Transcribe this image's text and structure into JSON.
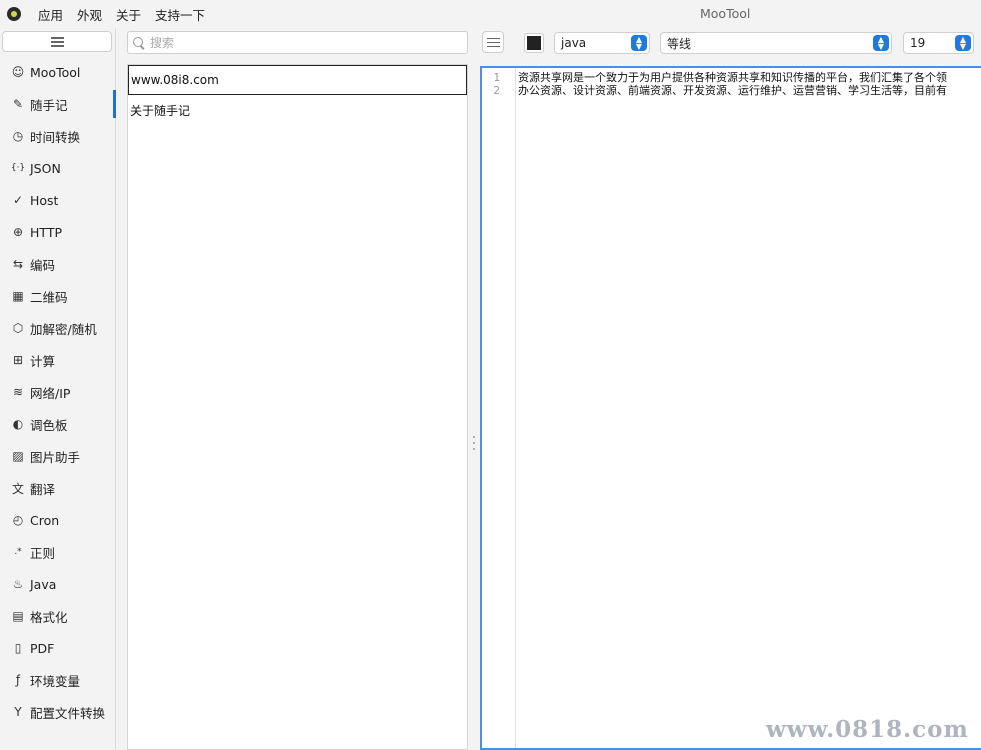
{
  "menu": [
    "应用",
    "外观",
    "关于",
    "支持一下"
  ],
  "window_title": "MooTool",
  "sidebar": {
    "items": [
      {
        "label": "MooTool",
        "icon": "smiley-icon"
      },
      {
        "label": "随手记",
        "icon": "pencil-icon",
        "active": true
      },
      {
        "label": "时间转换",
        "icon": "clock-icon"
      },
      {
        "label": "JSON",
        "icon": "braces-icon"
      },
      {
        "label": "Host",
        "icon": "checkmark-icon"
      },
      {
        "label": "HTTP",
        "icon": "globe-icon"
      },
      {
        "label": "编码",
        "icon": "swap-arrows-icon"
      },
      {
        "label": "二维码",
        "icon": "qrcode-icon"
      },
      {
        "label": "加解密/随机",
        "icon": "cube-icon"
      },
      {
        "label": "计算",
        "icon": "calculator-icon"
      },
      {
        "label": "网络/IP",
        "icon": "wifi-icon"
      },
      {
        "label": "调色板",
        "icon": "palette-icon"
      },
      {
        "label": "图片助手",
        "icon": "image-icon"
      },
      {
        "label": "翻译",
        "icon": "translate-icon"
      },
      {
        "label": "Cron",
        "icon": "cron-icon"
      },
      {
        "label": "正则",
        "icon": "regex-icon"
      },
      {
        "label": "Java",
        "icon": "java-icon"
      },
      {
        "label": "格式化",
        "icon": "paint-roller-icon"
      },
      {
        "label": "PDF",
        "icon": "pdf-icon"
      },
      {
        "label": "环境变量",
        "icon": "function-icon"
      },
      {
        "label": "配置文件转换",
        "icon": "yml-icon"
      }
    ]
  },
  "search": {
    "placeholder": "搜索",
    "value": ""
  },
  "notes": [
    {
      "title": "www.08i8.com",
      "selected": true
    },
    {
      "title": "关于随手记",
      "selected": false
    }
  ],
  "toolbar": {
    "color": "#222222",
    "language": "java",
    "font": "等线",
    "font_size": "19"
  },
  "editor": {
    "lines": [
      "资源共享网是一个致力于为用户提供各种资源共享和知识传播的平台，我们汇集了各个领",
      "办公资源、设计资源、前端资源、开发资源、运行维护、运营营销、学习生活等，目前有"
    ]
  },
  "watermark": "www.0818.com"
}
